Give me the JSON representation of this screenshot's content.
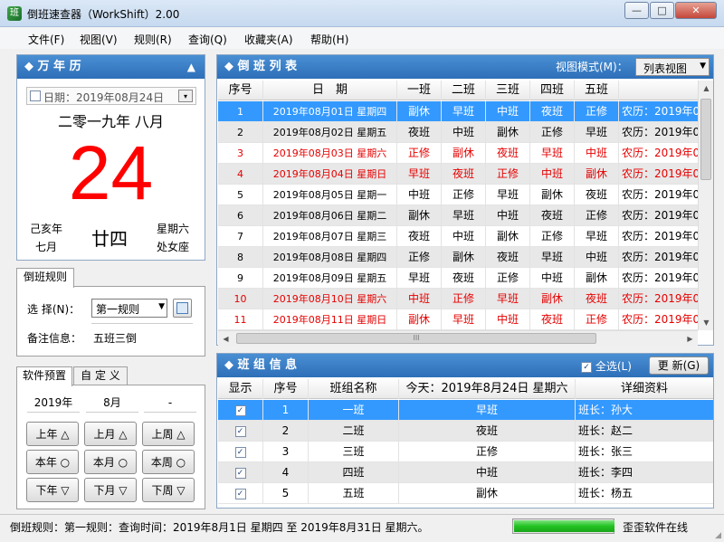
{
  "window": {
    "title": "倒班速查器（WorkShift）2.00",
    "btn_min": "—",
    "btn_max": "□",
    "btn_close": "✕"
  },
  "menu": [
    "文件(F)",
    "视图(V)",
    "规则(R)",
    "查询(Q)",
    "收藏夹(A)",
    "帮助(H)"
  ],
  "calendar": {
    "header": "◆ 万 年 历",
    "collapse_icon": "▲",
    "date_label": "日期：2019年08月24日",
    "chinese_month": "二零一九年 八月",
    "day": "24",
    "ganzhi_year": "己亥年",
    "lunar_month": "七月",
    "lunar_day": "廿四",
    "weekday": "星期六",
    "zodiac": "处女座"
  },
  "rules": {
    "tab": "倒班规则",
    "select_label": "选 择(N)：",
    "select_value": "第一规则",
    "note_label": "备注信息：",
    "note_value": "五班三倒"
  },
  "presets": {
    "tab1": "软件预置",
    "tab2": "自 定 义",
    "year": "2019年",
    "month": "8月",
    "dash": "-",
    "buttons": [
      "上年 △",
      "上月 △",
      "上周 △",
      "本年 ○",
      "本月 ○",
      "本周 ○",
      "下年 ▽",
      "下月 ▽",
      "下周 ▽"
    ]
  },
  "shift_table": {
    "header": "◆ 倒 班 列 表",
    "view_mode_label": "视图模式(M)：",
    "view_mode_value": "列表视图",
    "columns": [
      "序号",
      "日　期",
      "一班",
      "二班",
      "三班",
      "四班",
      "五班",
      ""
    ],
    "rows": [
      {
        "no": "1",
        "date": "2019年08月01日 星期四",
        "s1": "副休",
        "s2": "早班",
        "s3": "中班",
        "s4": "夜班",
        "s5": "正修",
        "lunar": "农历：2019年07",
        "kind": "selected"
      },
      {
        "no": "2",
        "date": "2019年08月02日 星期五",
        "s1": "夜班",
        "s2": "中班",
        "s3": "副休",
        "s4": "正修",
        "s5": "早班",
        "lunar": "农历：2019年07",
        "kind": "normal"
      },
      {
        "no": "3",
        "date": "2019年08月03日 星期六",
        "s1": "正修",
        "s2": "副休",
        "s3": "夜班",
        "s4": "早班",
        "s5": "中班",
        "lunar": "农历：2019年07",
        "kind": "weekend"
      },
      {
        "no": "4",
        "date": "2019年08月04日 星期日",
        "s1": "早班",
        "s2": "夜班",
        "s3": "正修",
        "s4": "中班",
        "s5": "副休",
        "lunar": "农历：2019年07",
        "kind": "weekend"
      },
      {
        "no": "5",
        "date": "2019年08月05日 星期一",
        "s1": "中班",
        "s2": "正修",
        "s3": "早班",
        "s4": "副休",
        "s5": "夜班",
        "lunar": "农历：2019年07",
        "kind": "normal"
      },
      {
        "no": "6",
        "date": "2019年08月06日 星期二",
        "s1": "副休",
        "s2": "早班",
        "s3": "中班",
        "s4": "夜班",
        "s5": "正修",
        "lunar": "农历：2019年07",
        "kind": "normal"
      },
      {
        "no": "7",
        "date": "2019年08月07日 星期三",
        "s1": "夜班",
        "s2": "中班",
        "s3": "副休",
        "s4": "正修",
        "s5": "早班",
        "lunar": "农历：2019年07",
        "kind": "normal"
      },
      {
        "no": "8",
        "date": "2019年08月08日 星期四",
        "s1": "正修",
        "s2": "副休",
        "s3": "夜班",
        "s4": "早班",
        "s5": "中班",
        "lunar": "农历：2019年07",
        "kind": "normal"
      },
      {
        "no": "9",
        "date": "2019年08月09日 星期五",
        "s1": "早班",
        "s2": "夜班",
        "s3": "正修",
        "s4": "中班",
        "s5": "副休",
        "lunar": "农历：2019年07",
        "kind": "normal"
      },
      {
        "no": "10",
        "date": "2019年08月10日 星期六",
        "s1": "中班",
        "s2": "正修",
        "s3": "早班",
        "s4": "副休",
        "s5": "夜班",
        "lunar": "农历：2019年07",
        "kind": "weekend"
      },
      {
        "no": "11",
        "date": "2019年08月11日 星期日",
        "s1": "副休",
        "s2": "早班",
        "s3": "中班",
        "s4": "夜班",
        "s5": "正修",
        "lunar": "农历：2019年07",
        "kind": "weekend"
      }
    ],
    "scroll_thumb": "III"
  },
  "group_info": {
    "header": "◆ 班 组 信 息",
    "select_all": "全选(L)",
    "refresh": "更 新(G)",
    "columns": [
      "显示",
      "序号",
      "班组名称",
      "今天：2019年8月24日 星期六",
      "详细资料"
    ],
    "rows": [
      {
        "checked": "✓",
        "no": "1",
        "name": "一班",
        "today": "早班",
        "detail": "班长：孙大"
      },
      {
        "checked": "✓",
        "no": "2",
        "name": "二班",
        "today": "夜班",
        "detail": "班长：赵二"
      },
      {
        "checked": "✓",
        "no": "3",
        "name": "三班",
        "today": "正修",
        "detail": "班长：张三"
      },
      {
        "checked": "✓",
        "no": "4",
        "name": "四班",
        "today": "中班",
        "detail": "班长：李四"
      },
      {
        "checked": "✓",
        "no": "5",
        "name": "五班",
        "today": "副休",
        "detail": "班长：杨五"
      }
    ]
  },
  "status": {
    "text": "倒班规则：第一规则：查询时间：2019年8月1日 星期四 至 2019年8月31日 星期六。",
    "progress": 1.0,
    "online": "歪歪软件在线"
  },
  "colors": {
    "accent": "#2d6fb8",
    "selected": "#3399ff",
    "weekend": "#e60000",
    "big_day": "#ff0000",
    "progress": "#22c322"
  }
}
